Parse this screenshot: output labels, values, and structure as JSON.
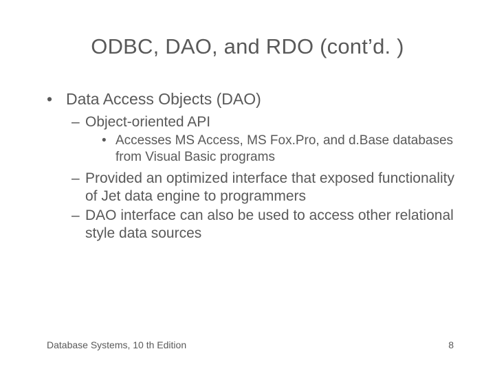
{
  "slide": {
    "title": "ODBC, DAO, and RDO (cont’d. )",
    "bullets": {
      "l1_0": "Data Access Objects (DAO)",
      "l2_0": "Object-oriented API",
      "l3_0": "Accesses MS Access, MS Fox.Pro, and d.Base databases from Visual Basic programs",
      "l2_1": "Provided an optimized interface that exposed functionality of Jet data engine to programmers",
      "l2_2": "DAO interface can also be used to access other relational style data sources"
    },
    "footer": {
      "left": "Database Systems, 10 th Edition",
      "page": "8"
    }
  }
}
